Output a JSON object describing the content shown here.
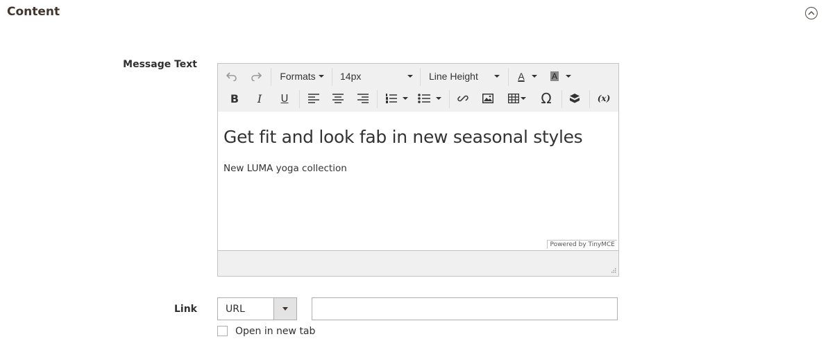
{
  "section": {
    "title": "Content",
    "collapse_icon": "chevron-up-circle-icon"
  },
  "message_text": {
    "label": "Message Text",
    "toolbar": {
      "row1": {
        "undo_icon": "undo-icon",
        "redo_icon": "redo-icon",
        "formats_label": "Formats",
        "font_size_value": "14px",
        "line_height_label": "Line Height",
        "text_color_icon": "text-color-icon",
        "text_color_glyph": "A",
        "background_color_icon": "background-color-icon",
        "background_color_glyph": "A"
      },
      "row2": {
        "bold_glyph": "B",
        "italic_glyph": "I",
        "underline_glyph": "U",
        "omega_glyph": "Ω",
        "variable_glyph": "(x)"
      }
    },
    "content": {
      "heading": "Get fit and look fab in new seasonal styles",
      "paragraph": "New LUMA yoga collection"
    },
    "powered_by": "Powered by TinyMCE"
  },
  "link": {
    "label": "Link",
    "type_value": "URL",
    "url_value": "",
    "open_new_tab_label": "Open in new tab",
    "open_new_tab_checked": false
  }
}
